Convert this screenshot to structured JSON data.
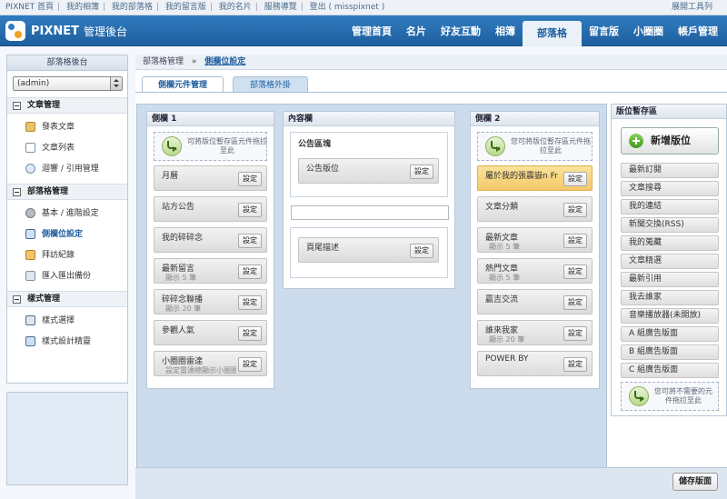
{
  "topbar": {
    "links": [
      "PIXNET 首頁",
      "我的相簿",
      "我的部落格",
      "我的留言版",
      "我的名片",
      "服務導覽",
      "登出 ( misspixnet )"
    ],
    "tools": "展開工具列"
  },
  "header": {
    "logo_text": "PIXNET",
    "logo_sub": "管理後台",
    "nav": [
      "管理首頁",
      "名片",
      "好友互動",
      "相簿",
      "部落格",
      "留言版",
      "小圈圈",
      "帳戶管理"
    ],
    "active_nav": "部落格"
  },
  "sidebar": {
    "title": "部落格後台",
    "select_value": "(admin)",
    "groups": [
      {
        "label": "文章管理",
        "items": [
          "發表文章",
          "文章列表",
          "迴響 / 引用管理"
        ]
      },
      {
        "label": "部落格管理",
        "items": [
          "基本 / 進階設定",
          "側欄位設定",
          "拜訪紀錄",
          "匯入匯出備份"
        ]
      },
      {
        "label": "樣式管理",
        "items": [
          "樣式選擇",
          "樣式設計精靈"
        ]
      }
    ],
    "active_item": "側欄位設定"
  },
  "breadcrumb": {
    "parent": "部落格管理",
    "sep": "»",
    "current": "側欄位設定"
  },
  "tabs": [
    "側欄元件管理",
    "部落格外掛"
  ],
  "columns": {
    "sidebar1": {
      "title": "側欄 1",
      "drop_hint": "可將版位暫存區元件拖拉至此",
      "modules": [
        {
          "name": "月曆",
          "sub": ""
        },
        {
          "name": "站方公告",
          "sub": ""
        },
        {
          "name": "我的碎碎念",
          "sub": ""
        },
        {
          "name": "最新留言",
          "sub": "顯示 5 筆"
        },
        {
          "name": "碎碎念聯播",
          "sub": "顯示 20 筆"
        },
        {
          "name": "參觀人氣",
          "sub": ""
        },
        {
          "name": "小圈圈雷達",
          "sub": "設定雷達總顯示小圈圈"
        }
      ]
    },
    "content": {
      "title": "內容欄",
      "group_title": "公告區塊",
      "modules": [
        {
          "name": "公告版位"
        }
      ],
      "footer_module": {
        "name": "頁尾描述"
      }
    },
    "sidebar2": {
      "title": "側欄 2",
      "drop_hint": "您可將版位暫存區元件拖拉至此",
      "modules": [
        {
          "name": "屬於我的張震嶽n Fr",
          "sub": "",
          "highlight": true
        },
        {
          "name": "文章分類",
          "sub": ""
        },
        {
          "name": "最新文章",
          "sub": "顯示 5 筆"
        },
        {
          "name": "熱門文章",
          "sub": "顯示 5 筆"
        },
        {
          "name": "贏吉交流",
          "sub": ""
        },
        {
          "name": "誰來我家",
          "sub": "顯示 20 筆"
        },
        {
          "name": "POWER BY",
          "sub": ""
        }
      ]
    },
    "setting_label": "設定"
  },
  "pool": {
    "title": "版位暫存區",
    "add_button": "新增版位",
    "items": [
      "最新訂閱",
      "文章搜尋",
      "我的連結",
      "新聞交換(RSS)",
      "我的蒐藏",
      "文章精選",
      "最新引用",
      "我去誰家",
      "音樂播放器(未開放)",
      "A 組廣告版面",
      "B 組廣告版面",
      "C 組廣告版面"
    ],
    "drop_hint": "您可將不需要的元件拖拉至此"
  },
  "footer": {
    "save_button": "儲存版面"
  }
}
